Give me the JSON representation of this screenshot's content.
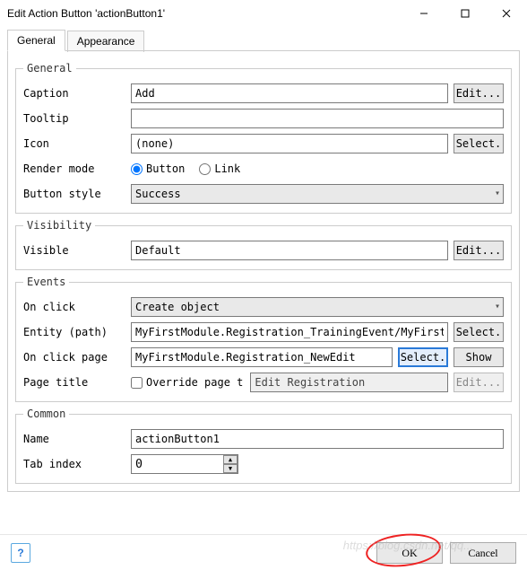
{
  "window": {
    "title": "Edit Action Button 'actionButton1'"
  },
  "tabs": {
    "general": "General",
    "appearance": "Appearance"
  },
  "groups": {
    "general": {
      "legend": "General",
      "caption_lbl": "Caption",
      "caption_val": "Add",
      "caption_edit": "Edit...",
      "tooltip_lbl": "Tooltip",
      "tooltip_val": "",
      "icon_lbl": "Icon",
      "icon_val": "(none)",
      "icon_select": "Select.",
      "render_lbl": "Render mode",
      "render_button": "Button",
      "render_link": "Link",
      "style_lbl": "Button style",
      "style_val": "Success"
    },
    "visibility": {
      "legend": "Visibility",
      "visible_lbl": "Visible",
      "visible_val": "Default",
      "visible_edit": "Edit..."
    },
    "events": {
      "legend": "Events",
      "onclick_lbl": "On click",
      "onclick_val": "Create object",
      "entity_lbl": "Entity (path)",
      "entity_val": "MyFirstModule.Registration_TrainingEvent/MyFirstModule.R",
      "entity_select": "Select.",
      "onclickpage_lbl": "On click page",
      "onclickpage_val": "MyFirstModule.Registration_NewEdit",
      "onclickpage_select": "Select.",
      "onclickpage_show": "Show",
      "pagetitle_lbl": "Page title",
      "override_lbl": "Override page t",
      "pagetitle_val": "Edit Registration",
      "pagetitle_edit": "Edit..."
    },
    "common": {
      "legend": "Common",
      "name_lbl": "Name",
      "name_val": "actionButton1",
      "tab_lbl": "Tab index",
      "tab_val": "0"
    }
  },
  "footer": {
    "ok": "OK",
    "cancel": "Cancel",
    "help": "?"
  },
  "watermark": "https://blog.csdn.net/qq..."
}
